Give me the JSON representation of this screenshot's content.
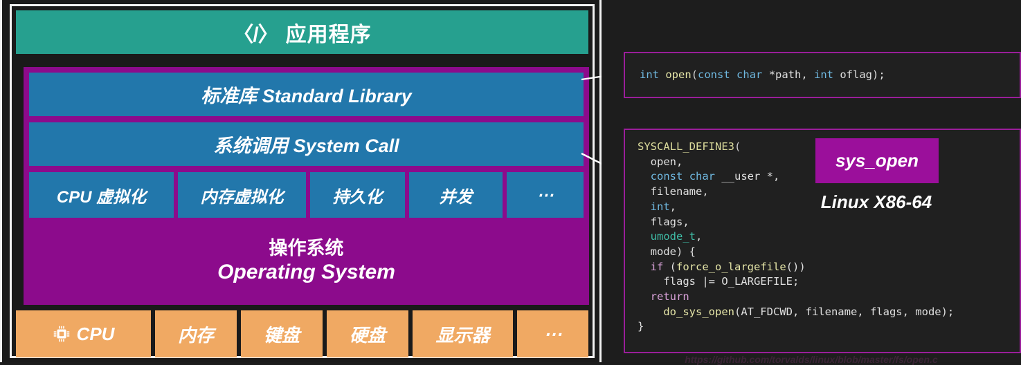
{
  "diagram": {
    "app_layer": {
      "icon": "code-brackets-icon",
      "icon_glyph": "〈/〉",
      "label": "应用程序",
      "color": "#26a08f"
    },
    "standard_library": {
      "label": "标准库 Standard Library",
      "color": "#2277ab"
    },
    "system_call": {
      "label": "系统调用 System Call",
      "color": "#2277ab"
    },
    "os_features": [
      {
        "label": "CPU 虚拟化"
      },
      {
        "label": "内存虚拟化"
      },
      {
        "label": "持久化"
      },
      {
        "label": "并发"
      },
      {
        "label": "⋯"
      }
    ],
    "os_layer": {
      "label_zh": "操作系统",
      "label_en": "Operating System",
      "color": "#8c0b8c"
    },
    "hardware": [
      {
        "label": "CPU",
        "icon": "microchip-icon"
      },
      {
        "label": "内存",
        "icon": ""
      },
      {
        "label": "键盘",
        "icon": ""
      },
      {
        "label": "硬盘",
        "icon": ""
      },
      {
        "label": "显示器",
        "icon": ""
      },
      {
        "label": "⋯",
        "icon": ""
      }
    ],
    "hardware_color": "#f0a963"
  },
  "code_panel": {
    "border_color": "#9a1e9a",
    "open_prototype": {
      "tokens": [
        {
          "t": "int",
          "c": "type"
        },
        {
          "t": " ",
          "c": "plain"
        },
        {
          "t": "open",
          "c": "fn"
        },
        {
          "t": "(",
          "c": "punc"
        },
        {
          "t": "const",
          "c": "type"
        },
        {
          "t": " ",
          "c": "plain"
        },
        {
          "t": "char",
          "c": "type"
        },
        {
          "t": " *path, ",
          "c": "plain"
        },
        {
          "t": "int",
          "c": "type"
        },
        {
          "t": " oflag);",
          "c": "plain"
        }
      ],
      "text": "int open(const char *path, int oflag);"
    },
    "syscall_source": {
      "lines": [
        {
          "text": "SYSCALL_DEFINE3(",
          "tokens": [
            {
              "t": "SYSCALL_DEFINE3",
              "c": "macro"
            },
            {
              "t": "(",
              "c": "punc"
            }
          ]
        },
        {
          "text": "  open,",
          "tokens": [
            {
              "t": "  open,",
              "c": "plain"
            }
          ]
        },
        {
          "text": "  const char __user *,",
          "tokens": [
            {
              "t": "  ",
              "c": "plain"
            },
            {
              "t": "const",
              "c": "type"
            },
            {
              "t": " ",
              "c": "plain"
            },
            {
              "t": "char",
              "c": "type"
            },
            {
              "t": " __user *,",
              "c": "plain"
            }
          ]
        },
        {
          "text": "  filename,",
          "tokens": [
            {
              "t": "  filename,",
              "c": "plain"
            }
          ]
        },
        {
          "text": "  int,",
          "tokens": [
            {
              "t": "  ",
              "c": "plain"
            },
            {
              "t": "int",
              "c": "type"
            },
            {
              "t": ",",
              "c": "plain"
            }
          ]
        },
        {
          "text": "  flags,",
          "tokens": [
            {
              "t": "  flags,",
              "c": "plain"
            }
          ]
        },
        {
          "text": "  umode_t,",
          "tokens": [
            {
              "t": "  ",
              "c": "plain"
            },
            {
              "t": "umode_t",
              "c": "teal"
            },
            {
              "t": ",",
              "c": "plain"
            }
          ]
        },
        {
          "text": "  mode) {",
          "tokens": [
            {
              "t": "  mode) {",
              "c": "plain"
            }
          ]
        },
        {
          "text": "  if (force_o_largefile())",
          "tokens": [
            {
              "t": "  ",
              "c": "plain"
            },
            {
              "t": "if",
              "c": "kw"
            },
            {
              "t": " (",
              "c": "plain"
            },
            {
              "t": "force_o_largefile",
              "c": "fn"
            },
            {
              "t": "())",
              "c": "plain"
            }
          ]
        },
        {
          "text": "    flags |= O_LARGEFILE;",
          "tokens": [
            {
              "t": "    flags |= O_LARGEFILE;",
              "c": "plain"
            }
          ]
        },
        {
          "text": "  return",
          "tokens": [
            {
              "t": "  ",
              "c": "plain"
            },
            {
              "t": "return",
              "c": "kw"
            }
          ]
        },
        {
          "text": "    do_sys_open(AT_FDCWD, filename, flags, mode);",
          "tokens": [
            {
              "t": "    ",
              "c": "plain"
            },
            {
              "t": "do_sys_open",
              "c": "fn"
            },
            {
              "t": "(AT_FDCWD, filename, flags, mode);",
              "c": "plain"
            }
          ]
        },
        {
          "text": "}",
          "tokens": [
            {
              "t": "}",
              "c": "plain"
            }
          ]
        }
      ]
    },
    "sys_badge_label": "sys_open",
    "sys_badge_color": "#9b0f9b",
    "arch_label": "Linux X86-64",
    "source_url": "https://github.com/torvalds/linux/blob/master/fs/open.c"
  }
}
